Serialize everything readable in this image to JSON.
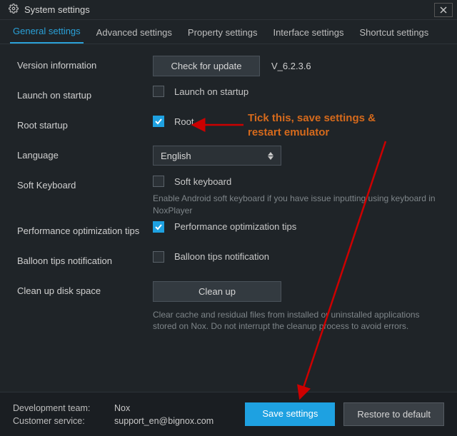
{
  "window": {
    "title": "System settings"
  },
  "tabs": {
    "general": "General settings",
    "advanced": "Advanced settings",
    "property": "Property settings",
    "interface": "Interface settings",
    "shortcut": "Shortcut settings"
  },
  "rows": {
    "version_label": "Version information",
    "check_update_btn": "Check for update",
    "version_value": "V_6.2.3.6",
    "launch_label": "Launch on startup",
    "launch_check": "Launch on startup",
    "root_label": "Root startup",
    "root_check": "Root",
    "language_label": "Language",
    "language_value": "English",
    "softkb_label": "Soft Keyboard",
    "softkb_check": "Soft keyboard",
    "softkb_desc": "Enable Android soft keyboard if you have issue inputting using keyboard in NoxPlayer",
    "perf_label": "Performance optimization tips",
    "perf_check": "Performance optimization tips",
    "balloon_label": "Balloon tips notification",
    "balloon_check": "Balloon tips notification",
    "cleanup_label": "Clean up disk space",
    "cleanup_btn": "Clean up",
    "cleanup_desc": "Clear cache and residual files from installed or uninstalled applications stored on Nox. Do not interrupt the cleanup process to avoid errors."
  },
  "bottom": {
    "dev_key": "Development team:",
    "dev_val": "Nox",
    "cs_key": "Customer service:",
    "cs_val": "support_en@bignox.com",
    "save_btn": "Save settings",
    "restore_btn": "Restore to default"
  },
  "annotation": {
    "line1": "Tick this, save settings &",
    "line2": "restart emulator"
  },
  "colors": {
    "accent": "#1ea1e1",
    "annotation": "#d66a1c"
  }
}
